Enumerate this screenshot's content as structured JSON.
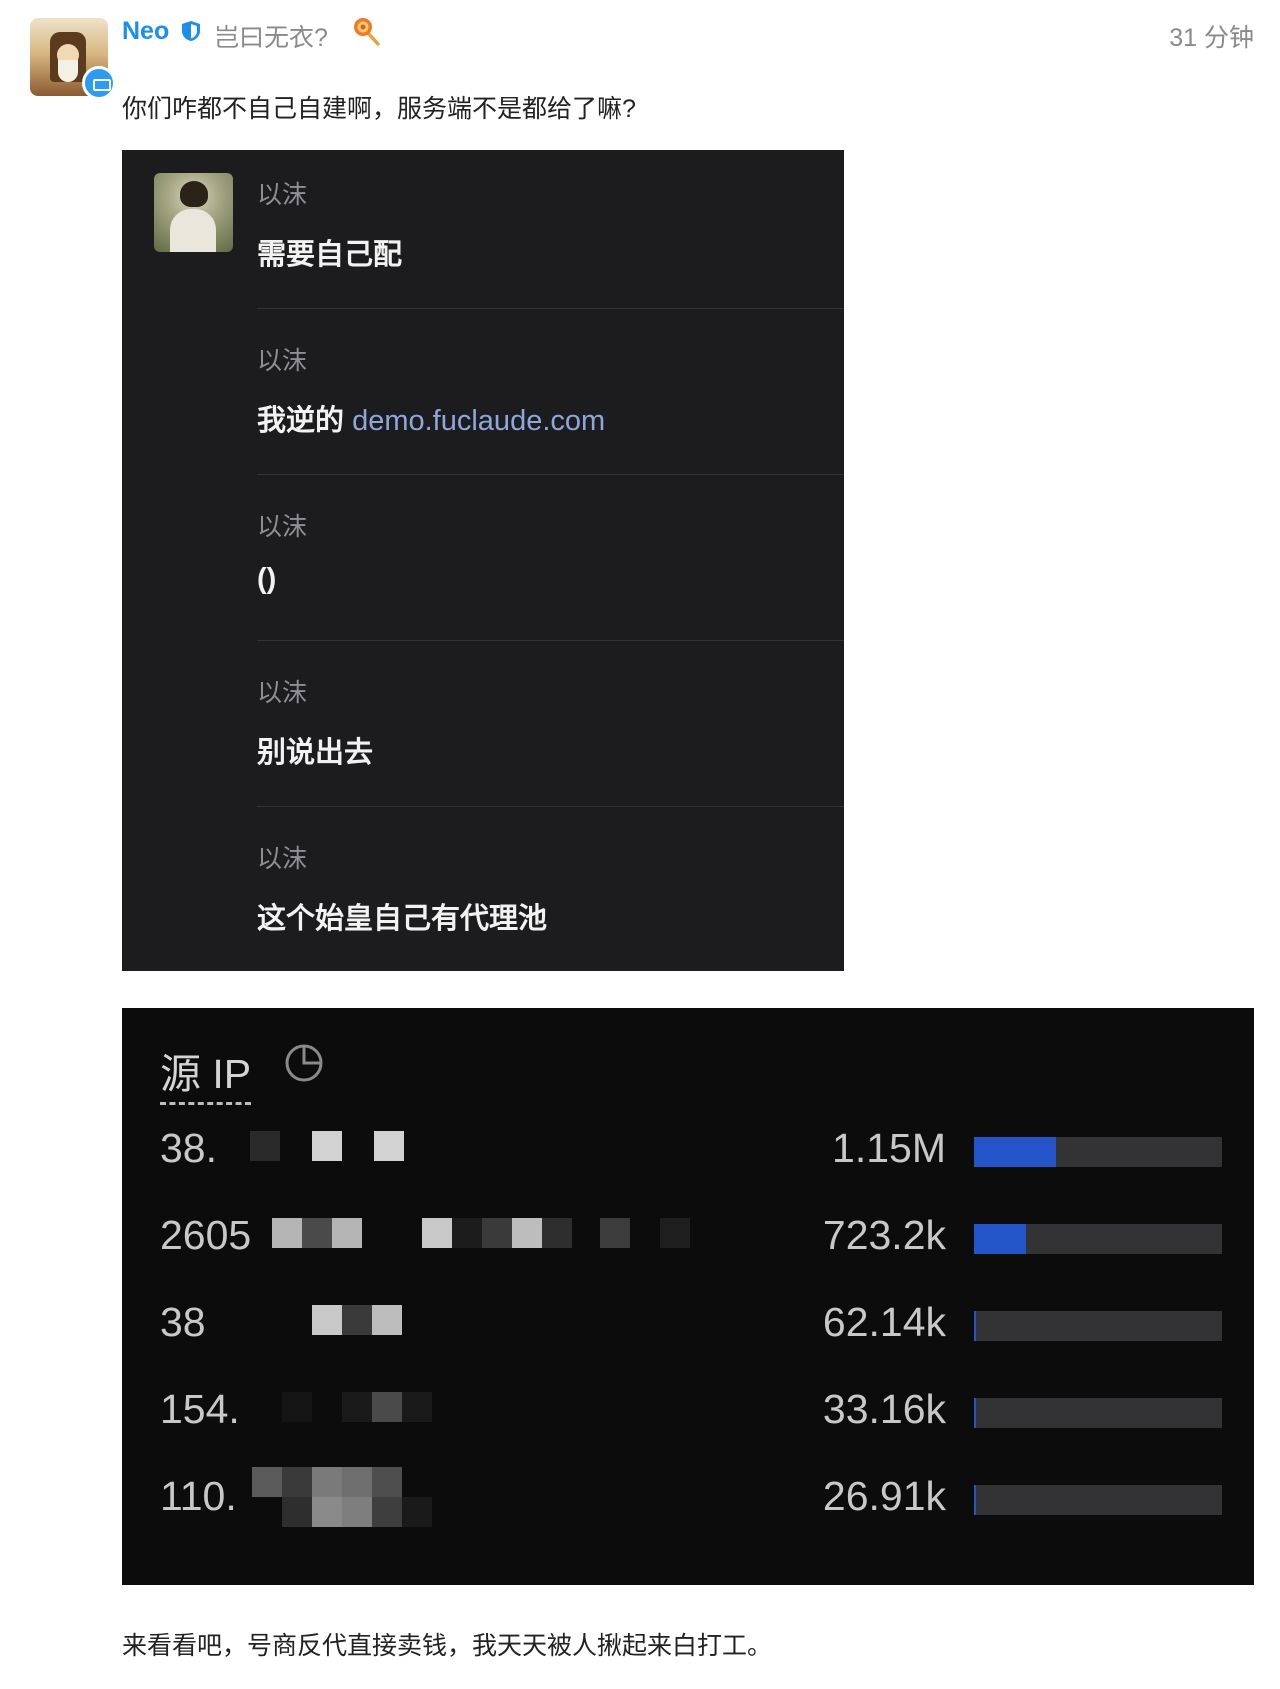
{
  "post": {
    "username": "Neo",
    "user_title": "岂曰无衣?",
    "timestamp": "31 分钟",
    "body_text": "你们咋都不自己自建啊，服务端不是都给了嘛?",
    "footer_text": "来看看吧，号商反代直接卖钱，我天天被人揪起来白打工。",
    "icons": {
      "verified": "shield-icon",
      "title": "lollipop-icon",
      "avatar_badge": "battery-icon"
    },
    "colors": {
      "username": "#1a8ff0",
      "meta": "#8a8a8a",
      "link": "#8ea6d8",
      "bar": "#2455c9"
    }
  },
  "chat": {
    "messages": [
      {
        "sender": "以沫",
        "text": "需要自己配"
      },
      {
        "sender": "以沫",
        "text": "我逆的",
        "link": "demo.fuclaude.com"
      },
      {
        "sender": "以沫",
        "text": "()"
      },
      {
        "sender": "以沫",
        "text": "别说出去"
      },
      {
        "sender": "以沫",
        "text": "这个始皇自己有代理池"
      }
    ]
  },
  "stats": {
    "title": "源 IP",
    "rows": [
      {
        "ip": "38.",
        "count": "1.15M",
        "fraction": 0.33
      },
      {
        "ip": "2605",
        "count": "723.2k",
        "fraction": 0.21
      },
      {
        "ip": "38",
        "count": "62.14k",
        "fraction": 0.01
      },
      {
        "ip": "154.",
        "count": "33.16k",
        "fraction": 0.006
      },
      {
        "ip": "110.",
        "count": "26.91k",
        "fraction": 0.005
      }
    ]
  }
}
